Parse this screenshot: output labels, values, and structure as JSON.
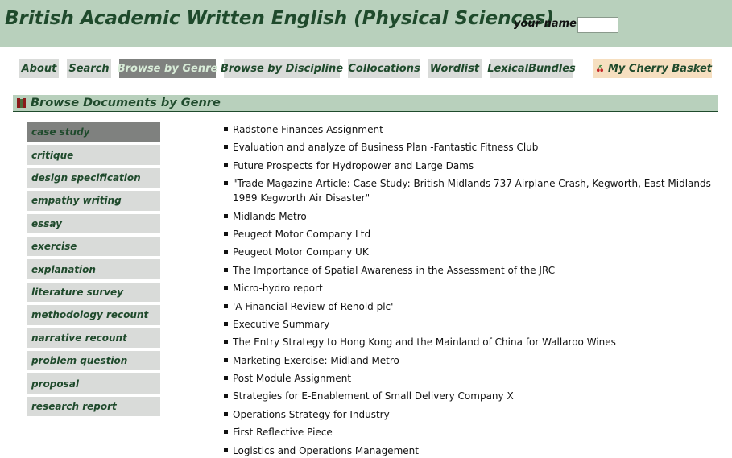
{
  "header": {
    "title": "British Academic Written English (Physical Sciences)",
    "name_label": "your name:",
    "name_value": ""
  },
  "nav": {
    "items": [
      {
        "label": "About"
      },
      {
        "label": "Search"
      },
      {
        "label": "Browse by Genre"
      },
      {
        "label": "Browse by Discipline"
      },
      {
        "label": "Collocations"
      },
      {
        "label": "Wordlist"
      },
      {
        "label": "LexicalBundles"
      }
    ],
    "active": "Browse by Genre",
    "cherry_basket": "My Cherry Basket"
  },
  "section": {
    "title": "Browse Documents by Genre"
  },
  "genres": {
    "items": [
      "case study",
      "critique",
      "design specification",
      "empathy writing",
      "essay",
      "exercise",
      "explanation",
      "literature survey",
      "methodology recount",
      "narrative recount",
      "problem question",
      "proposal",
      "research report"
    ],
    "active": "case study"
  },
  "documents": [
    "Radstone Finances Assignment",
    "Evaluation and analyze of Business Plan -Fantastic Fitness Club",
    "Future Prospects for Hydropower and Large Dams",
    "\"Trade Magazine Article: Case Study: British Midlands 737 Airplane Crash, Kegworth, East Midlands 1989 Kegworth Air Disaster\"",
    "Midlands Metro",
    "Peugeot Motor Company Ltd",
    "Peugeot Motor Company UK",
    "The Importance of Spatial Awareness in the Assessment of the JRC",
    "Micro-hydro report",
    "'A Financial Review of Renold plc'",
    "Executive Summary",
    "The Entry Strategy to Hong Kong and the Mainland of China for Wallaroo Wines",
    "Marketing Exercise: Midland Metro",
    "Post Module Assignment",
    "Strategies for E-Enablement of Small Delivery Company X",
    "Operations Strategy for Industry",
    "First Reflective Piece",
    "Logistics and Operations Management"
  ],
  "colors": {
    "header_bg": "#b8d0bc",
    "brand_green": "#1f4a2c",
    "button_bg": "#d9dbd9",
    "active_bg": "#7f817f",
    "cherry_bg": "#f6dfc0"
  }
}
